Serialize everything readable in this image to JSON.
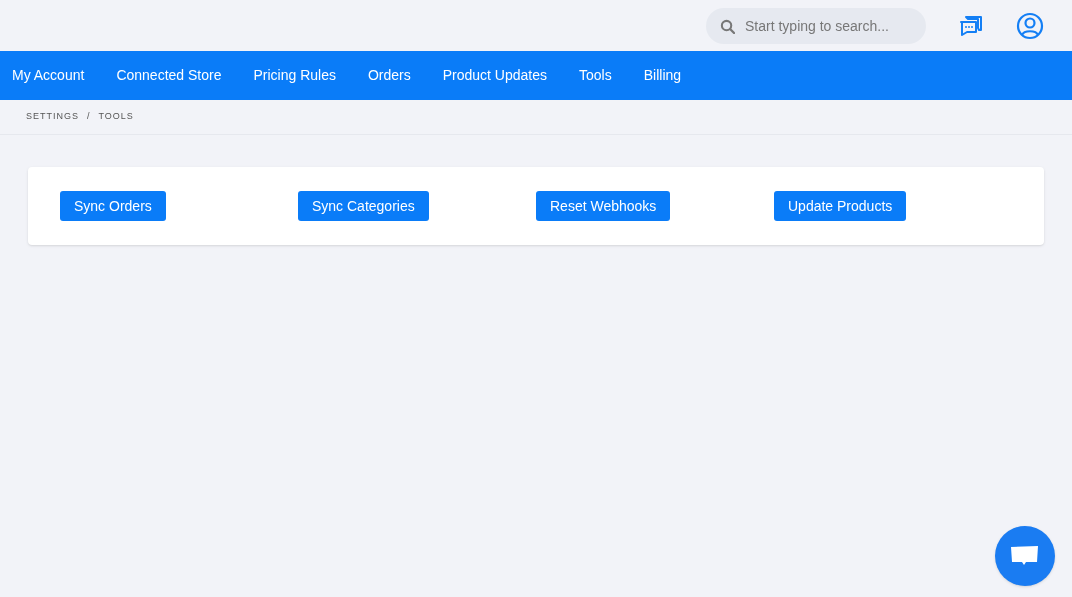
{
  "search": {
    "placeholder": "Start typing to search..."
  },
  "nav": [
    {
      "label": "My Account"
    },
    {
      "label": "Connected Store"
    },
    {
      "label": "Pricing Rules"
    },
    {
      "label": "Orders"
    },
    {
      "label": "Product Updates"
    },
    {
      "label": "Tools"
    },
    {
      "label": "Billing"
    }
  ],
  "breadcrumb": [
    "SETTINGS",
    "TOOLS"
  ],
  "breadcrumb_separator": "/",
  "tools": [
    "Sync Orders",
    "Sync Categories",
    "Reset Webhooks",
    "Update Products"
  ]
}
